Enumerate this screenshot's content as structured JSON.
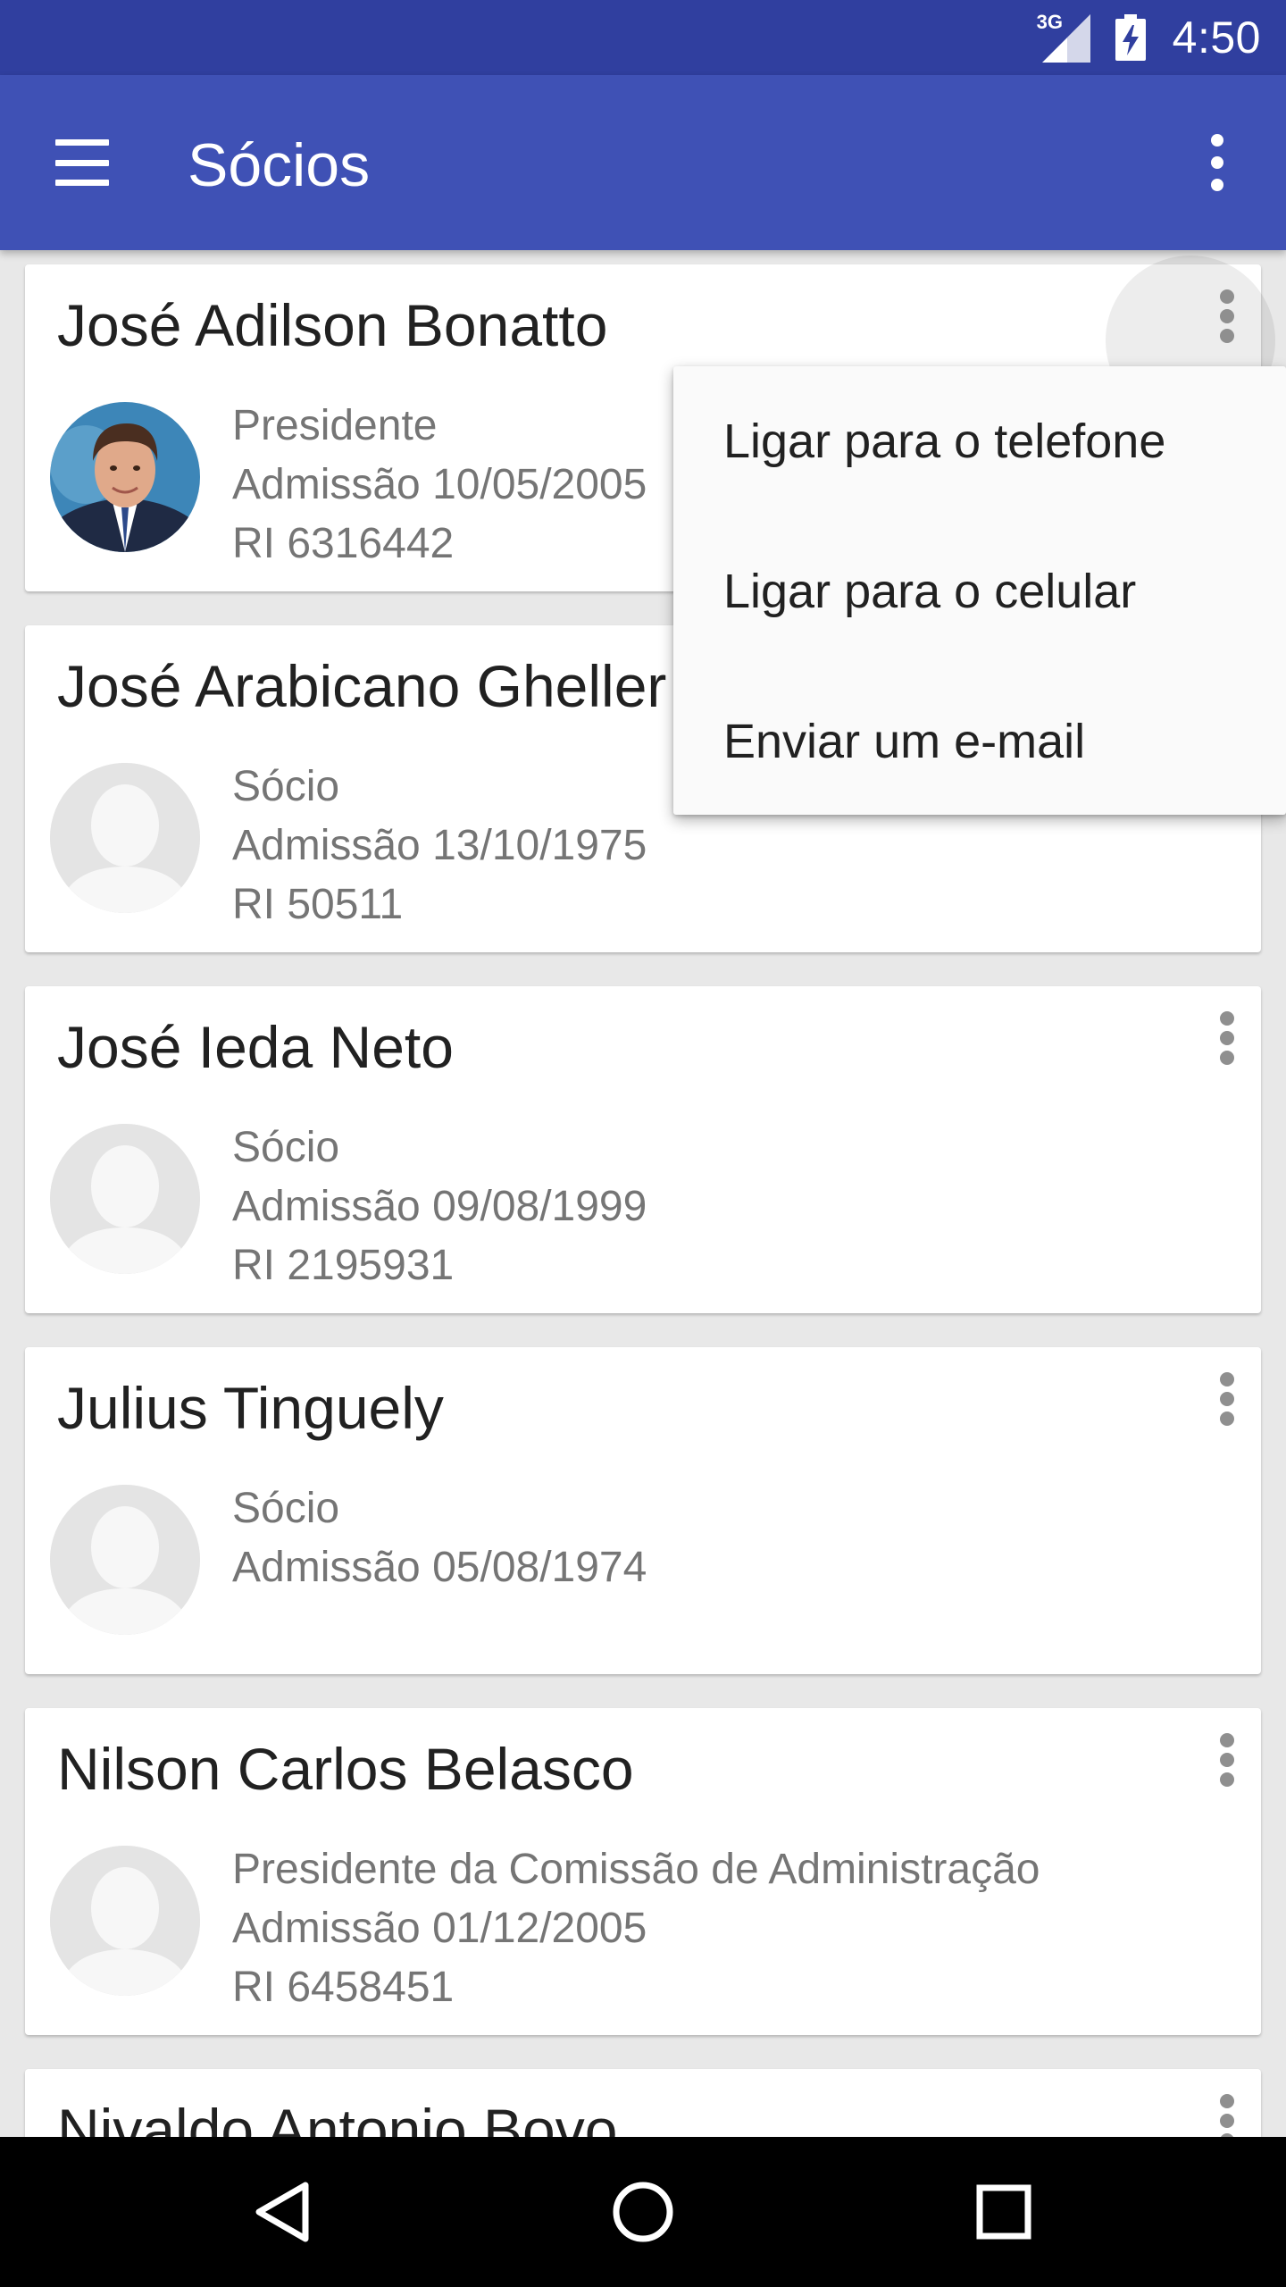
{
  "status_bar": {
    "network_type": "3G",
    "clock": "4:50",
    "icons": [
      "cell-signal-icon",
      "battery-charging-icon"
    ]
  },
  "app_bar": {
    "title": "Sócios",
    "menu_icon": "hamburger-menu-icon",
    "overflow_icon": "more-vert-icon",
    "color": "#3f51b5",
    "status_color": "#303f9f"
  },
  "members": [
    {
      "name": "José Adilson Bonatto",
      "avatar": "photo",
      "lines": [
        "Presidente",
        "Admissão 10/05/2005",
        "RI 6316442"
      ]
    },
    {
      "name": "José Arabicano Gheller",
      "avatar": "placeholder",
      "lines": [
        "Sócio",
        "Admissão 13/10/1975",
        "RI 50511"
      ]
    },
    {
      "name": "José Ieda Neto",
      "avatar": "placeholder",
      "lines": [
        "Sócio",
        "Admissão 09/08/1999",
        "RI 2195931"
      ]
    },
    {
      "name": "Julius Tinguely",
      "avatar": "placeholder",
      "lines": [
        "Sócio",
        "Admissão 05/08/1974"
      ]
    },
    {
      "name": "Nilson Carlos Belasco",
      "avatar": "placeholder",
      "lines": [
        "Presidente da Comissão de Administração",
        "Admissão 01/12/2005",
        "RI 6458451"
      ]
    },
    {
      "name": "Nivaldo Antonio Bovo",
      "avatar": "placeholder",
      "lines": []
    }
  ],
  "popup_menu": {
    "items": [
      "Ligar para o telefone",
      "Ligar para o celular",
      "Enviar um e-mail"
    ]
  },
  "nav_bar": {
    "icons": [
      "back-icon",
      "home-icon",
      "recents-icon"
    ]
  }
}
